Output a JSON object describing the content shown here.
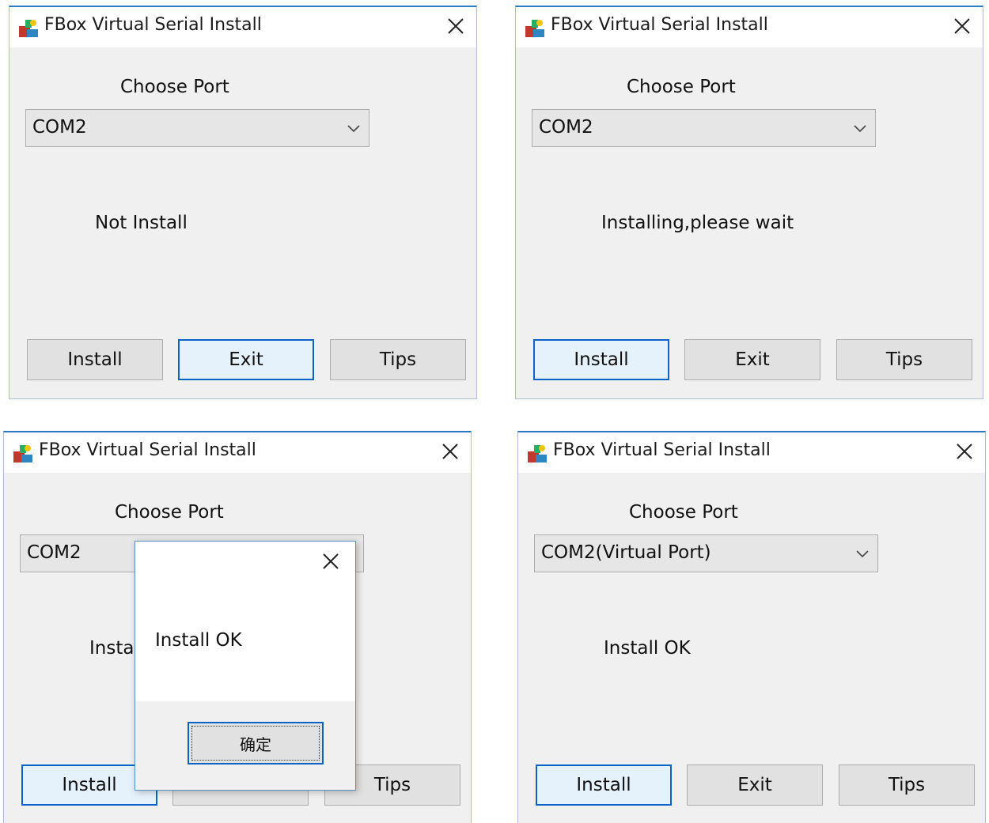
{
  "window_title": "FBox Virtual Serial Install",
  "choose_port_label": "Choose Port",
  "buttons": {
    "install": "Install",
    "exit": "Exit",
    "tips": "Tips"
  },
  "panels": [
    {
      "port": "COM2",
      "status": "Not Install",
      "focused_button": "exit"
    },
    {
      "port": "COM2",
      "status": "Installing,please wait",
      "focused_button": "install"
    },
    {
      "port": "COM2",
      "status": "Install OK",
      "focused_button": "install"
    },
    {
      "port": "COM2(Virtual Port)",
      "status": "Install OK",
      "focused_button": "install"
    }
  ],
  "dialog": {
    "message": "Install OK",
    "ok_label": "确定"
  },
  "icons": {
    "app": "installer-app-icon",
    "close": "close-icon",
    "dropdown": "chevron-down-icon"
  },
  "colors": {
    "title_border": "#2b79c2",
    "focus_border": "#0a64c8",
    "client_bg": "#f0f0f0"
  }
}
